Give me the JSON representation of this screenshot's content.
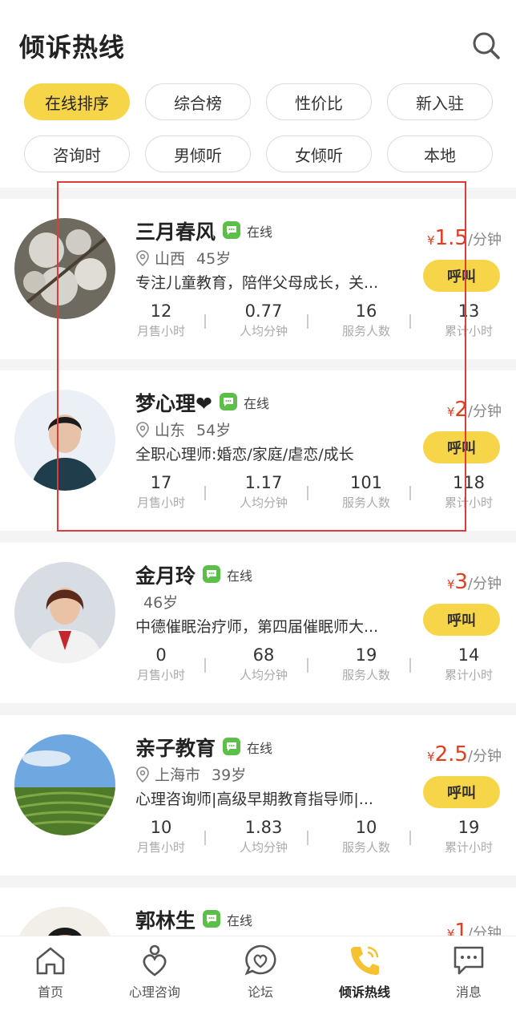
{
  "header": {
    "title": "倾诉热线"
  },
  "filters": [
    {
      "label": "在线排序",
      "active": true
    },
    {
      "label": "综合榜",
      "active": false
    },
    {
      "label": "性价比",
      "active": false
    },
    {
      "label": "新入驻",
      "active": false
    },
    {
      "label": "咨询时",
      "active": false
    },
    {
      "label": "男倾听",
      "active": false
    },
    {
      "label": "女倾听",
      "active": false
    },
    {
      "label": "本地",
      "active": false
    }
  ],
  "listeners": [
    {
      "name": "三月春风",
      "status": "在线",
      "province": "山西",
      "age": "45岁",
      "bio": "专注儿童教育，陪伴父母成长，关...",
      "price_symbol": "¥",
      "price": "1.5",
      "unit": "/分钟",
      "call": "呼叫",
      "stats": [
        {
          "value": "12",
          "label": "月售小时"
        },
        {
          "value": "0.77",
          "label": "人均分钟"
        },
        {
          "value": "16",
          "label": "服务人数"
        },
        {
          "value": "13",
          "label": "累计小时"
        }
      ]
    },
    {
      "name": "梦心理❤",
      "status": "在线",
      "province": "山东",
      "age": "54岁",
      "bio": "全职心理师:婚恋/家庭/虐恋/成长",
      "price_symbol": "¥",
      "price": "2",
      "unit": "/分钟",
      "call": "呼叫",
      "stats": [
        {
          "value": "17",
          "label": "月售小时"
        },
        {
          "value": "1.17",
          "label": "人均分钟"
        },
        {
          "value": "101",
          "label": "服务人数"
        },
        {
          "value": "118",
          "label": "累计小时"
        }
      ]
    },
    {
      "name": "金月玲",
      "status": "在线",
      "province": "",
      "age": "46岁",
      "bio": "中德催眠治疗师，第四届催眠师大...",
      "price_symbol": "¥",
      "price": "3",
      "unit": "/分钟",
      "call": "呼叫",
      "stats": [
        {
          "value": "0",
          "label": "月售小时"
        },
        {
          "value": "68",
          "label": "人均分钟"
        },
        {
          "value": "19",
          "label": "服务人数"
        },
        {
          "value": "14",
          "label": "累计小时"
        }
      ]
    },
    {
      "name": "亲子教育",
      "status": "在线",
      "province": "上海市",
      "age": "39岁",
      "bio": "心理咨询师|高级早期教育指导师|...",
      "price_symbol": "¥",
      "price": "2.5",
      "unit": "/分钟",
      "call": "呼叫",
      "stats": [
        {
          "value": "10",
          "label": "月售小时"
        },
        {
          "value": "1.83",
          "label": "人均分钟"
        },
        {
          "value": "10",
          "label": "服务人数"
        },
        {
          "value": "19",
          "label": "累计小时"
        }
      ]
    },
    {
      "name": "郭林生",
      "status": "在线",
      "price_symbol": "¥",
      "price": "1",
      "unit": "/分钟"
    }
  ],
  "tabbar": [
    {
      "label": "首页",
      "icon": "home-icon",
      "active": false
    },
    {
      "label": "心理咨询",
      "icon": "heart-person-icon",
      "active": false
    },
    {
      "label": "论坛",
      "icon": "chat-heart-icon",
      "active": false
    },
    {
      "label": "倾诉热线",
      "icon": "phone-icon",
      "active": true
    },
    {
      "label": "消息",
      "icon": "message-icon",
      "active": false
    }
  ],
  "colors": {
    "accent": "#f7d548",
    "price": "#e03e1f",
    "online_icon": "#5cbf4a",
    "highlight_box": "#e03a3a"
  }
}
